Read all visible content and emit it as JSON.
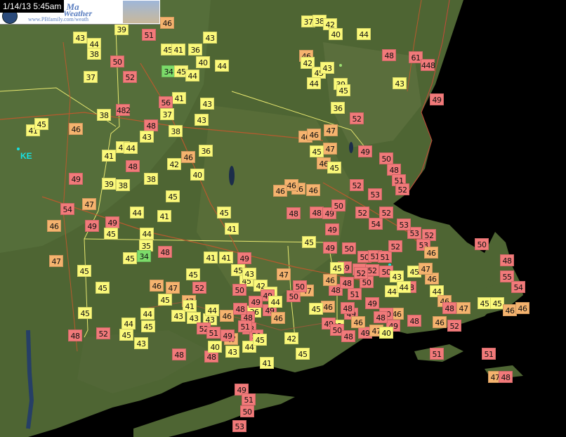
{
  "header": {
    "timestamp": "1/14/13 5:45am",
    "site_name_line1": "ord, Ma",
    "site_name_line2": "Weather",
    "site_url": "www.PBfamily.com/weath"
  },
  "station_marker": "KE",
  "legend_colors": {
    "green": "#7cdb6a",
    "yellow": "#fbf97a",
    "orange": "#f5b36e",
    "red": "#f27a7a"
  },
  "observations": [
    {
      "t": "46",
      "c": "orange"
    },
    {
      "t": "39",
      "c": "yellow"
    },
    {
      "t": "51",
      "c": "red"
    },
    {
      "t": "43",
      "c": "yellow"
    },
    {
      "t": "43",
      "c": "yellow"
    },
    {
      "t": "44",
      "c": "yellow"
    },
    {
      "t": "38",
      "c": "yellow"
    },
    {
      "t": "45",
      "c": "yellow"
    },
    {
      "t": "41",
      "c": "yellow"
    },
    {
      "t": "36",
      "c": "yellow"
    },
    {
      "t": "37",
      "c": "yellow"
    },
    {
      "t": "50",
      "c": "red"
    },
    {
      "t": "52",
      "c": "red"
    },
    {
      "t": "40",
      "c": "yellow"
    },
    {
      "t": "44",
      "c": "yellow"
    },
    {
      "t": "34",
      "c": "green"
    },
    {
      "t": "45",
      "c": "yellow"
    },
    {
      "t": "44",
      "c": "yellow"
    },
    {
      "t": "41",
      "c": "yellow"
    },
    {
      "t": "56",
      "c": "red"
    },
    {
      "t": "38",
      "c": "yellow"
    },
    {
      "t": "482",
      "c": "red"
    },
    {
      "t": "37",
      "c": "yellow"
    },
    {
      "t": "43",
      "c": "yellow"
    },
    {
      "t": "43",
      "c": "yellow"
    },
    {
      "t": "41",
      "c": "yellow"
    },
    {
      "t": "45",
      "c": "yellow"
    },
    {
      "t": "46",
      "c": "orange"
    },
    {
      "t": "48",
      "c": "red"
    },
    {
      "t": "43",
      "c": "yellow"
    },
    {
      "t": "38",
      "c": "yellow"
    },
    {
      "t": "45",
      "c": "yellow"
    },
    {
      "t": "41",
      "c": "yellow"
    },
    {
      "t": "44",
      "c": "yellow"
    },
    {
      "t": "46",
      "c": "orange"
    },
    {
      "t": "42",
      "c": "yellow"
    },
    {
      "t": "40",
      "c": "yellow"
    },
    {
      "t": "38",
      "c": "yellow"
    },
    {
      "t": "48",
      "c": "red"
    },
    {
      "t": "36",
      "c": "yellow"
    },
    {
      "t": "39",
      "c": "yellow"
    },
    {
      "t": "38",
      "c": "yellow"
    },
    {
      "t": "49",
      "c": "red"
    },
    {
      "t": "47",
      "c": "orange"
    },
    {
      "t": "54",
      "c": "red"
    },
    {
      "t": "46",
      "c": "orange"
    },
    {
      "t": "49",
      "c": "red"
    },
    {
      "t": "49",
      "c": "red"
    },
    {
      "t": "45",
      "c": "yellow"
    },
    {
      "t": "44",
      "c": "yellow"
    },
    {
      "t": "45",
      "c": "yellow"
    },
    {
      "t": "41",
      "c": "yellow"
    },
    {
      "t": "44",
      "c": "yellow"
    },
    {
      "t": "35",
      "c": "yellow"
    },
    {
      "t": "34",
      "c": "green"
    },
    {
      "t": "45",
      "c": "yellow"
    },
    {
      "t": "47",
      "c": "orange"
    },
    {
      "t": "45",
      "c": "yellow"
    },
    {
      "t": "45",
      "c": "yellow"
    },
    {
      "t": "46",
      "c": "orange"
    },
    {
      "t": "48",
      "c": "red"
    },
    {
      "t": "47",
      "c": "orange"
    },
    {
      "t": "45",
      "c": "yellow"
    },
    {
      "t": "52",
      "c": "red"
    },
    {
      "t": "47",
      "c": "orange"
    },
    {
      "t": "44",
      "c": "yellow"
    },
    {
      "t": "44",
      "c": "yellow"
    },
    {
      "t": "45",
      "c": "yellow"
    },
    {
      "t": "52",
      "c": "red"
    },
    {
      "t": "48",
      "c": "red"
    },
    {
      "t": "45",
      "c": "yellow"
    },
    {
      "t": "43",
      "c": "yellow"
    },
    {
      "t": "45",
      "c": "yellow"
    },
    {
      "t": "48",
      "c": "red"
    },
    {
      "t": "48",
      "c": "red"
    },
    {
      "t": "41",
      "c": "yellow"
    },
    {
      "t": "43",
      "c": "yellow"
    },
    {
      "t": "45",
      "c": "yellow"
    },
    {
      "t": "43",
      "c": "yellow"
    },
    {
      "t": "43",
      "c": "yellow"
    },
    {
      "t": "41",
      "c": "yellow"
    },
    {
      "t": "41",
      "c": "yellow"
    },
    {
      "t": "45",
      "c": "yellow"
    },
    {
      "t": "45",
      "c": "yellow"
    },
    {
      "t": "42",
      "c": "yellow"
    },
    {
      "t": "43",
      "c": "yellow"
    },
    {
      "t": "46",
      "c": "orange"
    },
    {
      "t": "47",
      "c": "orange"
    },
    {
      "t": "47",
      "c": "orange"
    },
    {
      "t": "45",
      "c": "yellow"
    },
    {
      "t": "46",
      "c": "orange"
    },
    {
      "t": "45",
      "c": "yellow"
    },
    {
      "t": "46",
      "c": "orange"
    },
    {
      "t": "46",
      "c": "orange"
    },
    {
      "t": "46",
      "c": "orange"
    },
    {
      "t": "46",
      "c": "orange"
    },
    {
      "t": "52",
      "c": "red"
    },
    {
      "t": "45",
      "c": "yellow"
    },
    {
      "t": "48",
      "c": "red"
    },
    {
      "t": "48",
      "c": "red"
    },
    {
      "t": "49",
      "c": "red"
    },
    {
      "t": "50",
      "c": "red"
    },
    {
      "t": "52",
      "c": "red"
    },
    {
      "t": "54",
      "c": "red"
    },
    {
      "t": "49",
      "c": "red"
    },
    {
      "t": "41",
      "c": "yellow"
    },
    {
      "t": "45",
      "c": "yellow"
    },
    {
      "t": "49",
      "c": "red"
    },
    {
      "t": "47",
      "c": "orange"
    },
    {
      "t": "49",
      "c": "red"
    },
    {
      "t": "43",
      "c": "yellow"
    },
    {
      "t": "49",
      "c": "red"
    },
    {
      "t": "50",
      "c": "red"
    },
    {
      "t": "47",
      "c": "orange"
    },
    {
      "t": "50",
      "c": "red"
    },
    {
      "t": "49",
      "c": "red"
    },
    {
      "t": "36",
      "c": "yellow"
    },
    {
      "t": "46",
      "c": "orange"
    },
    {
      "t": "50",
      "c": "red"
    },
    {
      "t": "50",
      "c": "red"
    },
    {
      "t": "51",
      "c": "red"
    },
    {
      "t": "51",
      "c": "red"
    },
    {
      "t": "52",
      "c": "red"
    },
    {
      "t": "53",
      "c": "red"
    },
    {
      "t": "52",
      "c": "red"
    },
    {
      "t": "37",
      "c": "yellow"
    },
    {
      "t": "38",
      "c": "yellow"
    },
    {
      "t": "42",
      "c": "yellow"
    },
    {
      "t": "40",
      "c": "yellow"
    },
    {
      "t": "44",
      "c": "yellow"
    },
    {
      "t": "46",
      "c": "orange"
    },
    {
      "t": "42",
      "c": "yellow"
    },
    {
      "t": "45",
      "c": "yellow"
    },
    {
      "t": "44",
      "c": "yellow"
    },
    {
      "t": "43",
      "c": "yellow"
    },
    {
      "t": "39",
      "c": "yellow"
    },
    {
      "t": "45",
      "c": "yellow"
    },
    {
      "t": "36",
      "c": "yellow"
    },
    {
      "t": "46",
      "c": "orange"
    },
    {
      "t": "48",
      "c": "red"
    },
    {
      "t": "43",
      "c": "yellow"
    },
    {
      "t": "61",
      "c": "red"
    },
    {
      "t": "448",
      "c": "red"
    },
    {
      "t": "49",
      "c": "red"
    },
    {
      "t": "52",
      "c": "red"
    },
    {
      "t": "49",
      "c": "red"
    },
    {
      "t": "50",
      "c": "red"
    },
    {
      "t": "48",
      "c": "red"
    },
    {
      "t": "51",
      "c": "red"
    },
    {
      "t": "52",
      "c": "red"
    },
    {
      "t": "53",
      "c": "red"
    },
    {
      "t": "52",
      "c": "red"
    },
    {
      "t": "53",
      "c": "red"
    },
    {
      "t": "53",
      "c": "red"
    },
    {
      "t": "46",
      "c": "orange"
    },
    {
      "t": "46",
      "c": "orange"
    },
    {
      "t": "50",
      "c": "red"
    },
    {
      "t": "48",
      "c": "red"
    },
    {
      "t": "55",
      "c": "red"
    },
    {
      "t": "54",
      "c": "red"
    },
    {
      "t": "44",
      "c": "yellow"
    },
    {
      "t": "46",
      "c": "orange"
    },
    {
      "t": "48",
      "c": "red"
    },
    {
      "t": "47",
      "c": "orange"
    },
    {
      "t": "45",
      "c": "yellow"
    },
    {
      "t": "45",
      "c": "yellow"
    },
    {
      "t": "46",
      "c": "orange"
    },
    {
      "t": "46",
      "c": "orange"
    },
    {
      "t": "48",
      "c": "red"
    },
    {
      "t": "46",
      "c": "orange"
    },
    {
      "t": "52",
      "c": "red"
    },
    {
      "t": "51",
      "c": "red"
    },
    {
      "t": "51",
      "c": "red"
    },
    {
      "t": "47",
      "c": "orange"
    },
    {
      "t": "48",
      "c": "red"
    },
    {
      "t": "48",
      "c": "red"
    },
    {
      "t": "46",
      "c": "orange"
    },
    {
      "t": "49",
      "c": "red"
    },
    {
      "t": "50",
      "c": "red"
    },
    {
      "t": "49",
      "c": "red"
    },
    {
      "t": "48",
      "c": "red"
    },
    {
      "t": "49",
      "c": "red"
    },
    {
      "t": "49",
      "c": "red"
    },
    {
      "t": "51",
      "c": "red"
    },
    {
      "t": "50",
      "c": "red"
    },
    {
      "t": "48",
      "c": "red"
    },
    {
      "t": "46",
      "c": "orange"
    },
    {
      "t": "49",
      "c": "red"
    },
    {
      "t": "50",
      "c": "red"
    },
    {
      "t": "52",
      "c": "red"
    },
    {
      "t": "50",
      "c": "red"
    },
    {
      "t": "43",
      "c": "yellow"
    },
    {
      "t": "44",
      "c": "yellow"
    },
    {
      "t": "44",
      "c": "yellow"
    },
    {
      "t": "45",
      "c": "yellow"
    },
    {
      "t": "47",
      "c": "orange"
    },
    {
      "t": "45",
      "c": "yellow"
    },
    {
      "t": "48",
      "c": "red"
    },
    {
      "t": "52",
      "c": "red"
    },
    {
      "t": "46",
      "c": "orange"
    },
    {
      "t": "48",
      "c": "red"
    },
    {
      "t": "46",
      "c": "orange"
    },
    {
      "t": "47",
      "c": "orange"
    },
    {
      "t": "43",
      "c": "yellow"
    },
    {
      "t": "40",
      "c": "yellow"
    },
    {
      "t": "45",
      "c": "yellow"
    },
    {
      "t": "44",
      "c": "yellow"
    },
    {
      "t": "48",
      "c": "red"
    },
    {
      "t": "48",
      "c": "red"
    },
    {
      "t": "50",
      "c": "red"
    },
    {
      "t": "47",
      "c": "orange"
    },
    {
      "t": "44",
      "c": "yellow"
    },
    {
      "t": "46",
      "c": "orange"
    },
    {
      "t": "48",
      "c": "red"
    },
    {
      "t": "49",
      "c": "red"
    },
    {
      "t": "50",
      "c": "red"
    },
    {
      "t": "51",
      "c": "red"
    },
    {
      "t": "52",
      "c": "red"
    },
    {
      "t": "51",
      "c": "red"
    },
    {
      "t": "49",
      "c": "red"
    },
    {
      "t": "40",
      "c": "yellow"
    },
    {
      "t": "43",
      "c": "yellow"
    },
    {
      "t": "44",
      "c": "yellow"
    },
    {
      "t": "45",
      "c": "yellow"
    },
    {
      "t": "41",
      "c": "yellow"
    },
    {
      "t": "42",
      "c": "yellow"
    },
    {
      "t": "45",
      "c": "yellow"
    },
    {
      "t": "49",
      "c": "red"
    },
    {
      "t": "50",
      "c": "red"
    },
    {
      "t": "48",
      "c": "red"
    },
    {
      "t": "49",
      "c": "red"
    },
    {
      "t": "51",
      "c": "red"
    },
    {
      "t": "50",
      "c": "red"
    },
    {
      "t": "53",
      "c": "red"
    }
  ]
}
